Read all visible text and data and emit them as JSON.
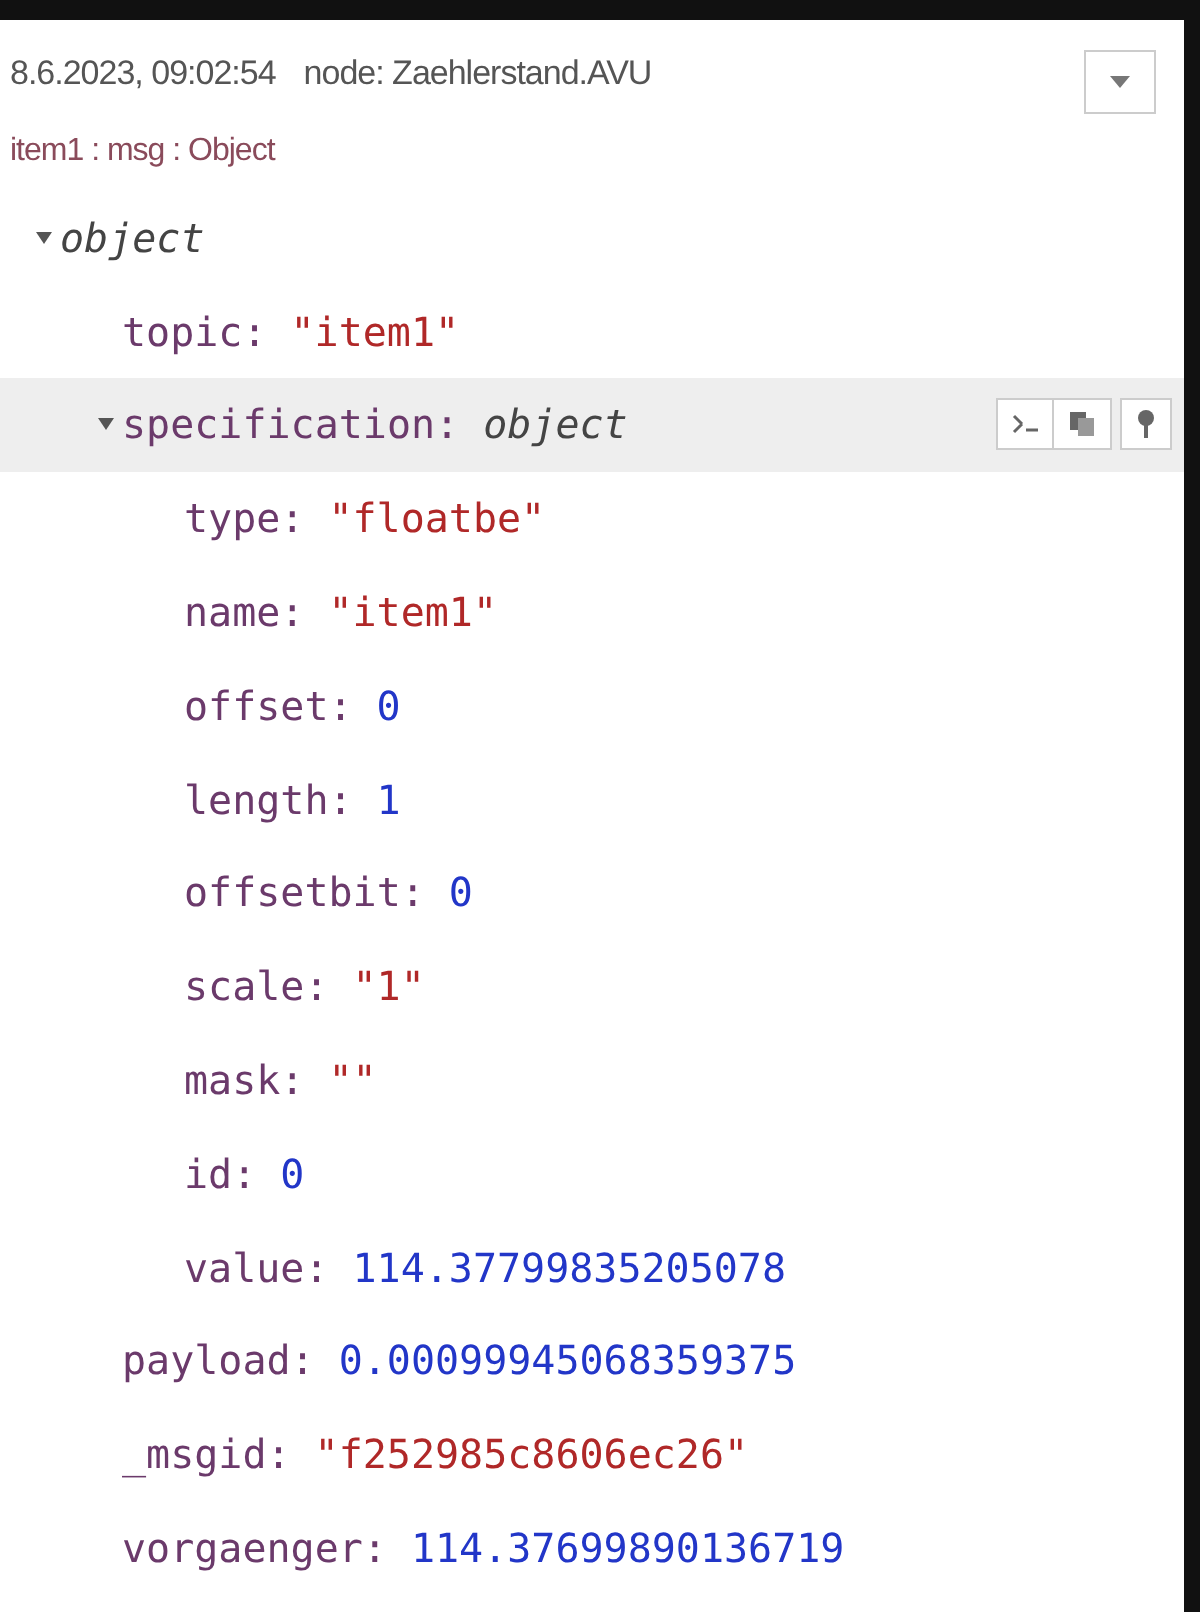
{
  "header": {
    "timestamp": "8.6.2023, 09:02:54",
    "node": "node: Zaehlerstand.AVU",
    "topic_line": "item1 : msg : Object"
  },
  "tree": {
    "label": "object",
    "expanded": true,
    "children": [
      {
        "key": "topic:",
        "value": "\"item1\"",
        "kind": "string"
      },
      {
        "key": "specification:",
        "value": "object",
        "kind": "object",
        "expanded": true,
        "selected": true,
        "children": [
          {
            "key": "type:",
            "value": "\"floatbe\"",
            "kind": "string"
          },
          {
            "key": "name:",
            "value": "\"item1\"",
            "kind": "string"
          },
          {
            "key": "offset:",
            "value": "0",
            "kind": "number"
          },
          {
            "key": "length:",
            "value": "1",
            "kind": "number"
          },
          {
            "key": "offsetbit:",
            "value": "0",
            "kind": "number"
          },
          {
            "key": "scale:",
            "value": "\"1\"",
            "kind": "string"
          },
          {
            "key": "mask:",
            "value": "\"\"",
            "kind": "string"
          },
          {
            "key": "id:",
            "value": "0",
            "kind": "number"
          },
          {
            "key": "value:",
            "value": "114.37799835205078",
            "kind": "number"
          }
        ]
      },
      {
        "key": "payload:",
        "value": "0.00099945068359375",
        "kind": "number"
      },
      {
        "key": "_msgid:",
        "value": "\"f252985c8606ec26\"",
        "kind": "string"
      },
      {
        "key": "vorgaenger:",
        "value": "114.37699890136719",
        "kind": "number"
      }
    ]
  }
}
